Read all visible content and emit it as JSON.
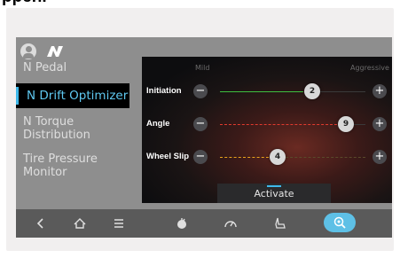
{
  "header_fragment": "ppen.",
  "sidebar": {
    "items": [
      {
        "label": "N Pedal",
        "active": false
      },
      {
        "label": "N Drift Optimizer",
        "active": true
      },
      {
        "label": "N Torque Distribution",
        "active": false
      },
      {
        "label": "Tire Pressure Monitor",
        "active": false
      }
    ]
  },
  "panel": {
    "mild_label": "Mild",
    "aggressive_label": "Aggressive",
    "rows": [
      {
        "label": "Initiation",
        "value": "2",
        "color": "#3fbf3f"
      },
      {
        "label": "Angle",
        "value": "9",
        "color": "#e23a2e"
      },
      {
        "label": "Wheel Slip",
        "value": "4",
        "color": "#e8a21c"
      }
    ],
    "minus_symbol": "−",
    "plus_symbol": "+",
    "activate_label": "Activate"
  },
  "bottom_nav": {
    "icons": [
      "back-icon",
      "home-icon",
      "menu-icon",
      "engine-icon",
      "gauge-icon",
      "seat-icon",
      "drift-mode-icon"
    ],
    "active_icon": "drift-mode-icon"
  },
  "colors": {
    "accent": "#3eb8ea",
    "active_menu_bg": "#000000",
    "screen_bg": "#8e8e8e",
    "nav_bg": "#5a5a5a"
  }
}
